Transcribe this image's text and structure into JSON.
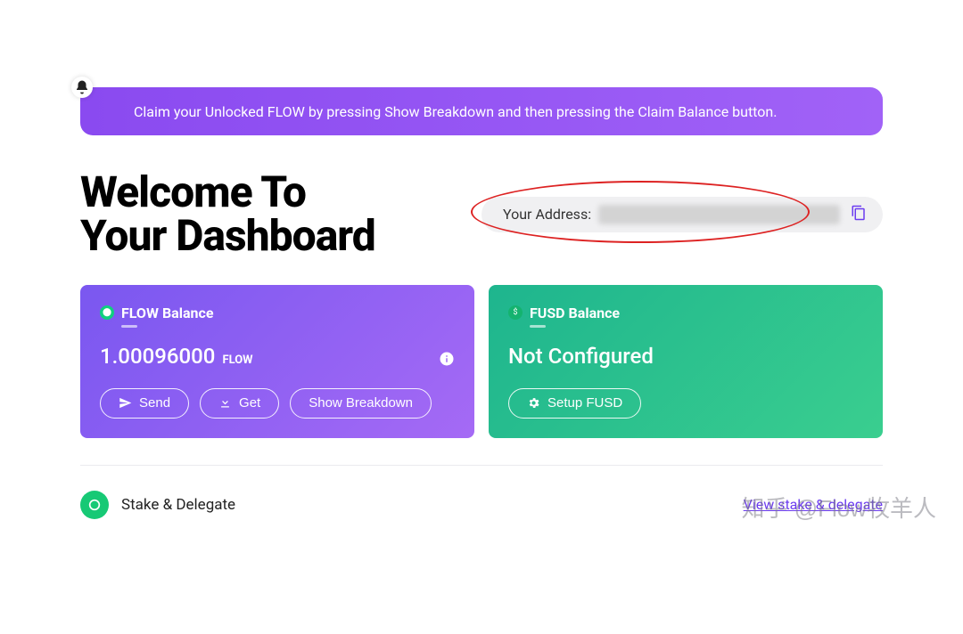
{
  "banner": {
    "text": "Claim your Unlocked FLOW by pressing Show Breakdown and then pressing the Claim Balance button."
  },
  "header": {
    "title_line1": "Welcome To",
    "title_line2": "Your Dashboard",
    "address_label": "Your Address:"
  },
  "flow_card": {
    "title": "FLOW Balance",
    "value": "1.00096000",
    "unit": "FLOW",
    "btn_send": "Send",
    "btn_get": "Get",
    "btn_breakdown": "Show Breakdown"
  },
  "fusd_card": {
    "title": "FUSD Balance",
    "status": "Not Configured",
    "btn_setup": "Setup FUSD"
  },
  "stake": {
    "title": "Stake & Delegate",
    "link": "View stake & delegate"
  },
  "watermark": "知乎 @Flow牧羊人"
}
